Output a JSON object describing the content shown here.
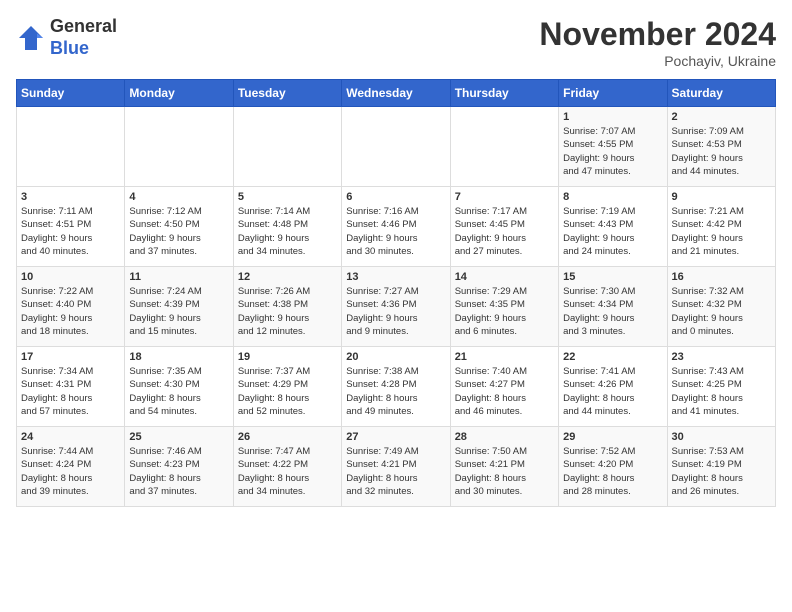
{
  "header": {
    "logo_line1": "General",
    "logo_line2": "Blue",
    "month_title": "November 2024",
    "location": "Pochayiv, Ukraine"
  },
  "weekdays": [
    "Sunday",
    "Monday",
    "Tuesday",
    "Wednesday",
    "Thursday",
    "Friday",
    "Saturday"
  ],
  "weeks": [
    [
      {
        "day": "",
        "info": ""
      },
      {
        "day": "",
        "info": ""
      },
      {
        "day": "",
        "info": ""
      },
      {
        "day": "",
        "info": ""
      },
      {
        "day": "",
        "info": ""
      },
      {
        "day": "1",
        "info": "Sunrise: 7:07 AM\nSunset: 4:55 PM\nDaylight: 9 hours\nand 47 minutes."
      },
      {
        "day": "2",
        "info": "Sunrise: 7:09 AM\nSunset: 4:53 PM\nDaylight: 9 hours\nand 44 minutes."
      }
    ],
    [
      {
        "day": "3",
        "info": "Sunrise: 7:11 AM\nSunset: 4:51 PM\nDaylight: 9 hours\nand 40 minutes."
      },
      {
        "day": "4",
        "info": "Sunrise: 7:12 AM\nSunset: 4:50 PM\nDaylight: 9 hours\nand 37 minutes."
      },
      {
        "day": "5",
        "info": "Sunrise: 7:14 AM\nSunset: 4:48 PM\nDaylight: 9 hours\nand 34 minutes."
      },
      {
        "day": "6",
        "info": "Sunrise: 7:16 AM\nSunset: 4:46 PM\nDaylight: 9 hours\nand 30 minutes."
      },
      {
        "day": "7",
        "info": "Sunrise: 7:17 AM\nSunset: 4:45 PM\nDaylight: 9 hours\nand 27 minutes."
      },
      {
        "day": "8",
        "info": "Sunrise: 7:19 AM\nSunset: 4:43 PM\nDaylight: 9 hours\nand 24 minutes."
      },
      {
        "day": "9",
        "info": "Sunrise: 7:21 AM\nSunset: 4:42 PM\nDaylight: 9 hours\nand 21 minutes."
      }
    ],
    [
      {
        "day": "10",
        "info": "Sunrise: 7:22 AM\nSunset: 4:40 PM\nDaylight: 9 hours\nand 18 minutes."
      },
      {
        "day": "11",
        "info": "Sunrise: 7:24 AM\nSunset: 4:39 PM\nDaylight: 9 hours\nand 15 minutes."
      },
      {
        "day": "12",
        "info": "Sunrise: 7:26 AM\nSunset: 4:38 PM\nDaylight: 9 hours\nand 12 minutes."
      },
      {
        "day": "13",
        "info": "Sunrise: 7:27 AM\nSunset: 4:36 PM\nDaylight: 9 hours\nand 9 minutes."
      },
      {
        "day": "14",
        "info": "Sunrise: 7:29 AM\nSunset: 4:35 PM\nDaylight: 9 hours\nand 6 minutes."
      },
      {
        "day": "15",
        "info": "Sunrise: 7:30 AM\nSunset: 4:34 PM\nDaylight: 9 hours\nand 3 minutes."
      },
      {
        "day": "16",
        "info": "Sunrise: 7:32 AM\nSunset: 4:32 PM\nDaylight: 9 hours\nand 0 minutes."
      }
    ],
    [
      {
        "day": "17",
        "info": "Sunrise: 7:34 AM\nSunset: 4:31 PM\nDaylight: 8 hours\nand 57 minutes."
      },
      {
        "day": "18",
        "info": "Sunrise: 7:35 AM\nSunset: 4:30 PM\nDaylight: 8 hours\nand 54 minutes."
      },
      {
        "day": "19",
        "info": "Sunrise: 7:37 AM\nSunset: 4:29 PM\nDaylight: 8 hours\nand 52 minutes."
      },
      {
        "day": "20",
        "info": "Sunrise: 7:38 AM\nSunset: 4:28 PM\nDaylight: 8 hours\nand 49 minutes."
      },
      {
        "day": "21",
        "info": "Sunrise: 7:40 AM\nSunset: 4:27 PM\nDaylight: 8 hours\nand 46 minutes."
      },
      {
        "day": "22",
        "info": "Sunrise: 7:41 AM\nSunset: 4:26 PM\nDaylight: 8 hours\nand 44 minutes."
      },
      {
        "day": "23",
        "info": "Sunrise: 7:43 AM\nSunset: 4:25 PM\nDaylight: 8 hours\nand 41 minutes."
      }
    ],
    [
      {
        "day": "24",
        "info": "Sunrise: 7:44 AM\nSunset: 4:24 PM\nDaylight: 8 hours\nand 39 minutes."
      },
      {
        "day": "25",
        "info": "Sunrise: 7:46 AM\nSunset: 4:23 PM\nDaylight: 8 hours\nand 37 minutes."
      },
      {
        "day": "26",
        "info": "Sunrise: 7:47 AM\nSunset: 4:22 PM\nDaylight: 8 hours\nand 34 minutes."
      },
      {
        "day": "27",
        "info": "Sunrise: 7:49 AM\nSunset: 4:21 PM\nDaylight: 8 hours\nand 32 minutes."
      },
      {
        "day": "28",
        "info": "Sunrise: 7:50 AM\nSunset: 4:21 PM\nDaylight: 8 hours\nand 30 minutes."
      },
      {
        "day": "29",
        "info": "Sunrise: 7:52 AM\nSunset: 4:20 PM\nDaylight: 8 hours\nand 28 minutes."
      },
      {
        "day": "30",
        "info": "Sunrise: 7:53 AM\nSunset: 4:19 PM\nDaylight: 8 hours\nand 26 minutes."
      }
    ]
  ]
}
